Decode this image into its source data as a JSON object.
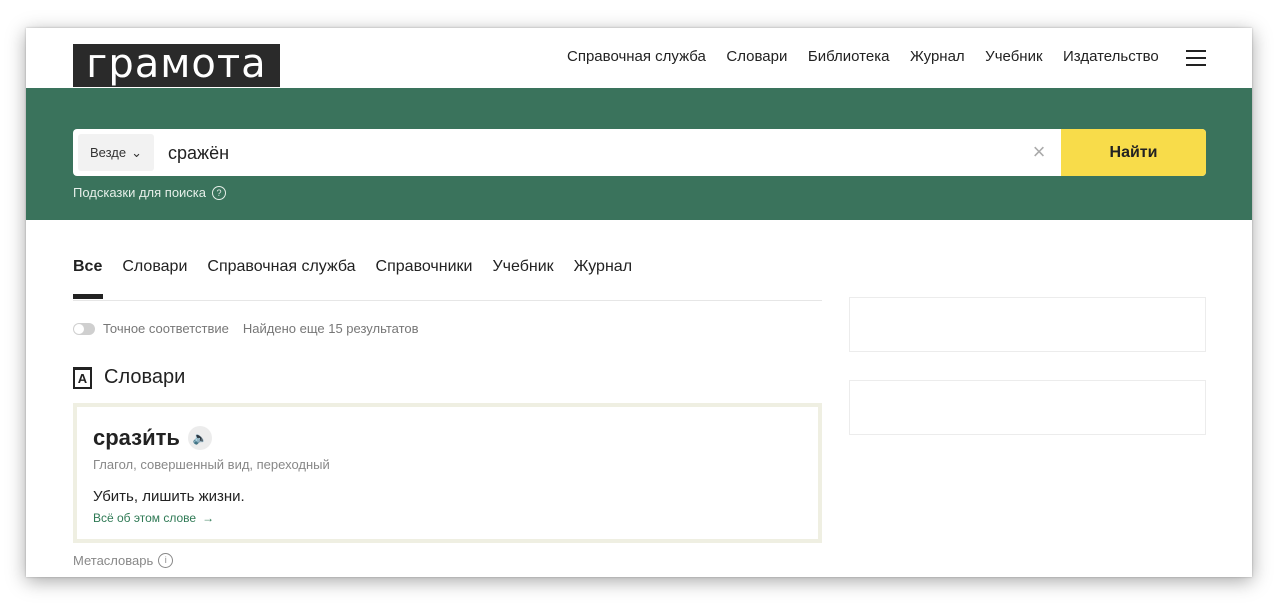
{
  "logo": "грамота",
  "nav": [
    "Справочная служба",
    "Словари",
    "Библиотека",
    "Журнал",
    "Учебник",
    "Издательство"
  ],
  "search": {
    "scope": "Везде",
    "query": "сражён",
    "button": "Найти",
    "hints": "Подсказки для поиска"
  },
  "tabs": [
    "Все",
    "Словари",
    "Справочная служба",
    "Справочники",
    "Учебник",
    "Журнал"
  ],
  "filters": {
    "exact": "Точное соответствие",
    "found": "Найдено еще 15 результатов"
  },
  "section": {
    "icon_letter": "А",
    "title": "Словари"
  },
  "entry": {
    "word": "срази́ть",
    "grammar": "Глагол, совершенный вид, переходный",
    "definition": "Убить, лишить жизни.",
    "more": "Всё об этом слове"
  },
  "source": "Метасловарь",
  "colors": {
    "band": "#3a735c",
    "button": "#f8dc4a",
    "link": "#2f7a55"
  }
}
